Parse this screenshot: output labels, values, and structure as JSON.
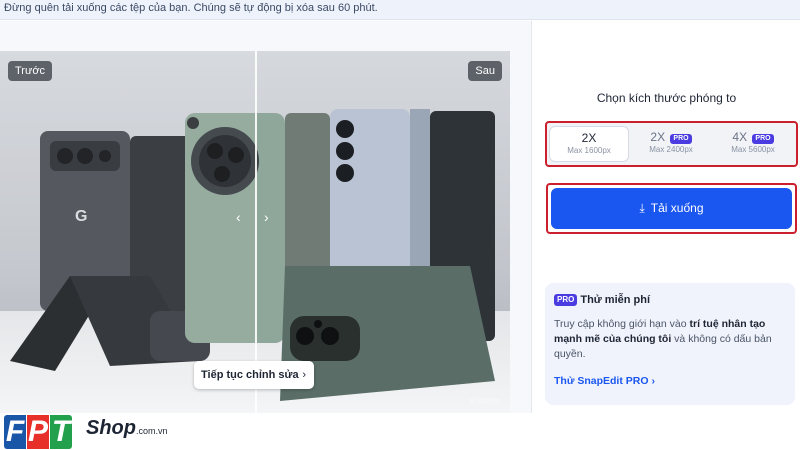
{
  "banner": {
    "text": "Đừng quên tải xuống các tệp của bạn. Chúng sẽ tự động bị xóa sau 60 phút."
  },
  "preview": {
    "before_label": "Trước",
    "after_label": "Sau",
    "continue_edit": "Tiếp tục chỉnh sửa",
    "watermark": "© fptshop",
    "compare_position": 0.5
  },
  "upscale": {
    "title": "Chọn kích thước phóng to",
    "options": [
      {
        "label": "2X",
        "max": "Max 1600px",
        "pro": false,
        "selected": true
      },
      {
        "label": "2X",
        "max": "Max 2400px",
        "pro": true,
        "selected": false
      },
      {
        "label": "4X",
        "max": "Max 5600px",
        "pro": true,
        "selected": false
      }
    ],
    "pro_badge": "PRO",
    "download_label": "Tải xuống"
  },
  "promo": {
    "badge": "PRO",
    "title": "Thử miễn phí",
    "body_pre": "Truy cập không giới hạn vào ",
    "body_bold1": "trí tuệ nhân tạo mạnh mẽ của chúng tôi",
    "body_post": " và không có dấu bản quyền.",
    "link": "Thử SnapEdit PRO",
    "link_chevron": "›"
  },
  "footer": {
    "logo_letters": [
      "F",
      "P",
      "T"
    ],
    "shop": "Shop",
    "domain": ".com.vn"
  },
  "colors": {
    "accent_blue": "#1a56f0",
    "highlight_red": "#cc1f2d",
    "pro_purple": "#4a3ce0"
  }
}
